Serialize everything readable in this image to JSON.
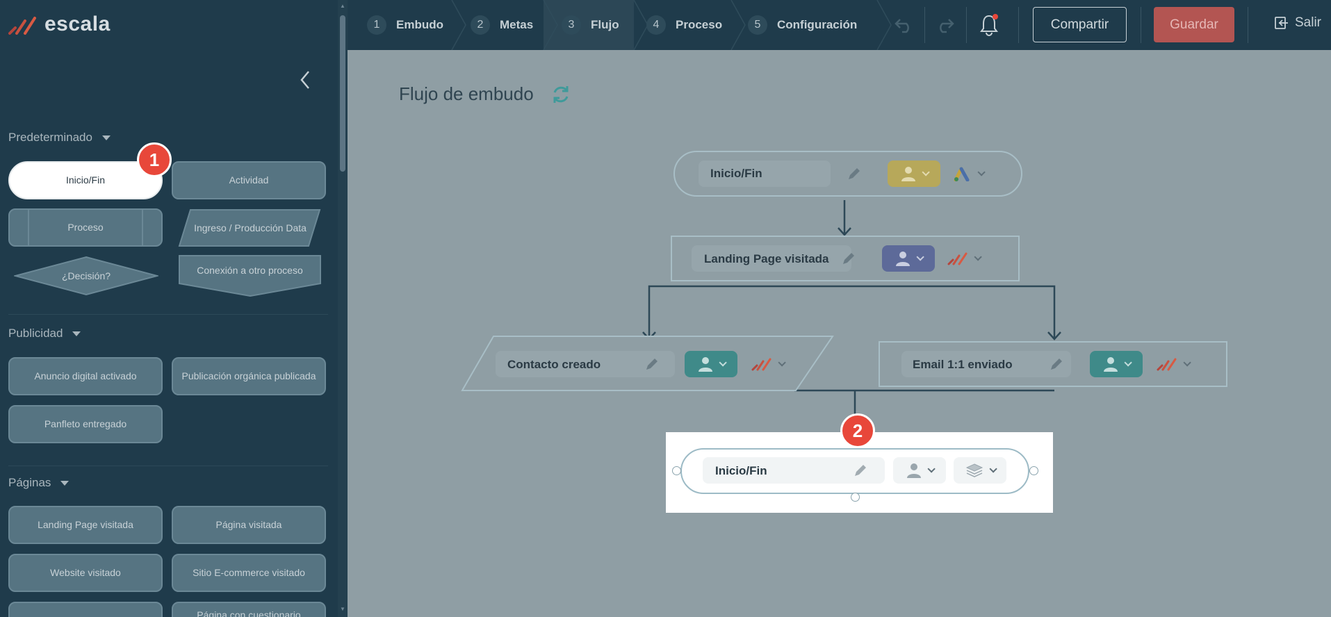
{
  "app": {
    "logo": "escala"
  },
  "sidebar": {
    "sections": [
      {
        "title": "Predeterminado"
      },
      {
        "title": "Publicidad"
      },
      {
        "title": "Páginas"
      }
    ],
    "predeterminado": {
      "inicio": "Inicio/Fin",
      "actividad": "Actividad",
      "proceso": "Proceso",
      "ingreso": "Ingreso / Producción Data",
      "decision": "¿Decisión?",
      "conexion": "Conexión a otro proceso"
    },
    "publicidad": {
      "anuncio": "Anuncio digital activado",
      "publicacion": "Publicación orgánica publicada",
      "panfleto": "Panfleto entregado"
    },
    "paginas": {
      "landing": "Landing Page visitada",
      "pagina": "Página visitada",
      "website": "Website visitado",
      "ecommerce": "Sitio E-commerce visitado",
      "cuestionario": "Página con cuestionario"
    }
  },
  "badges": {
    "one": "1",
    "two": "2"
  },
  "steps": [
    {
      "num": "1",
      "label": "Embudo"
    },
    {
      "num": "2",
      "label": "Metas"
    },
    {
      "num": "3",
      "label": "Flujo"
    },
    {
      "num": "4",
      "label": "Proceso"
    },
    {
      "num": "5",
      "label": "Configuración"
    }
  ],
  "toolbar": {
    "share": "Compartir",
    "save": "Guardar",
    "exit": "Salir"
  },
  "canvas": {
    "title": "Flujo de embudo"
  },
  "flow": {
    "start": {
      "label": "Inicio/Fin"
    },
    "landing": {
      "label": "Landing Page visitada"
    },
    "contacto": {
      "label": "Contacto creado"
    },
    "email": {
      "label": "Email 1:1 enviado"
    },
    "new_node": {
      "label": "Inicio/Fin"
    }
  },
  "colors": {
    "sidebar_bg": "#1f3b4b",
    "canvas_bg": "#8f9ea4",
    "accent_red": "#e8473a",
    "chip_yellow": "#b7a85a",
    "chip_blue": "#5d6a99",
    "chip_teal": "#3f8a89",
    "save_button": "#b35552"
  }
}
